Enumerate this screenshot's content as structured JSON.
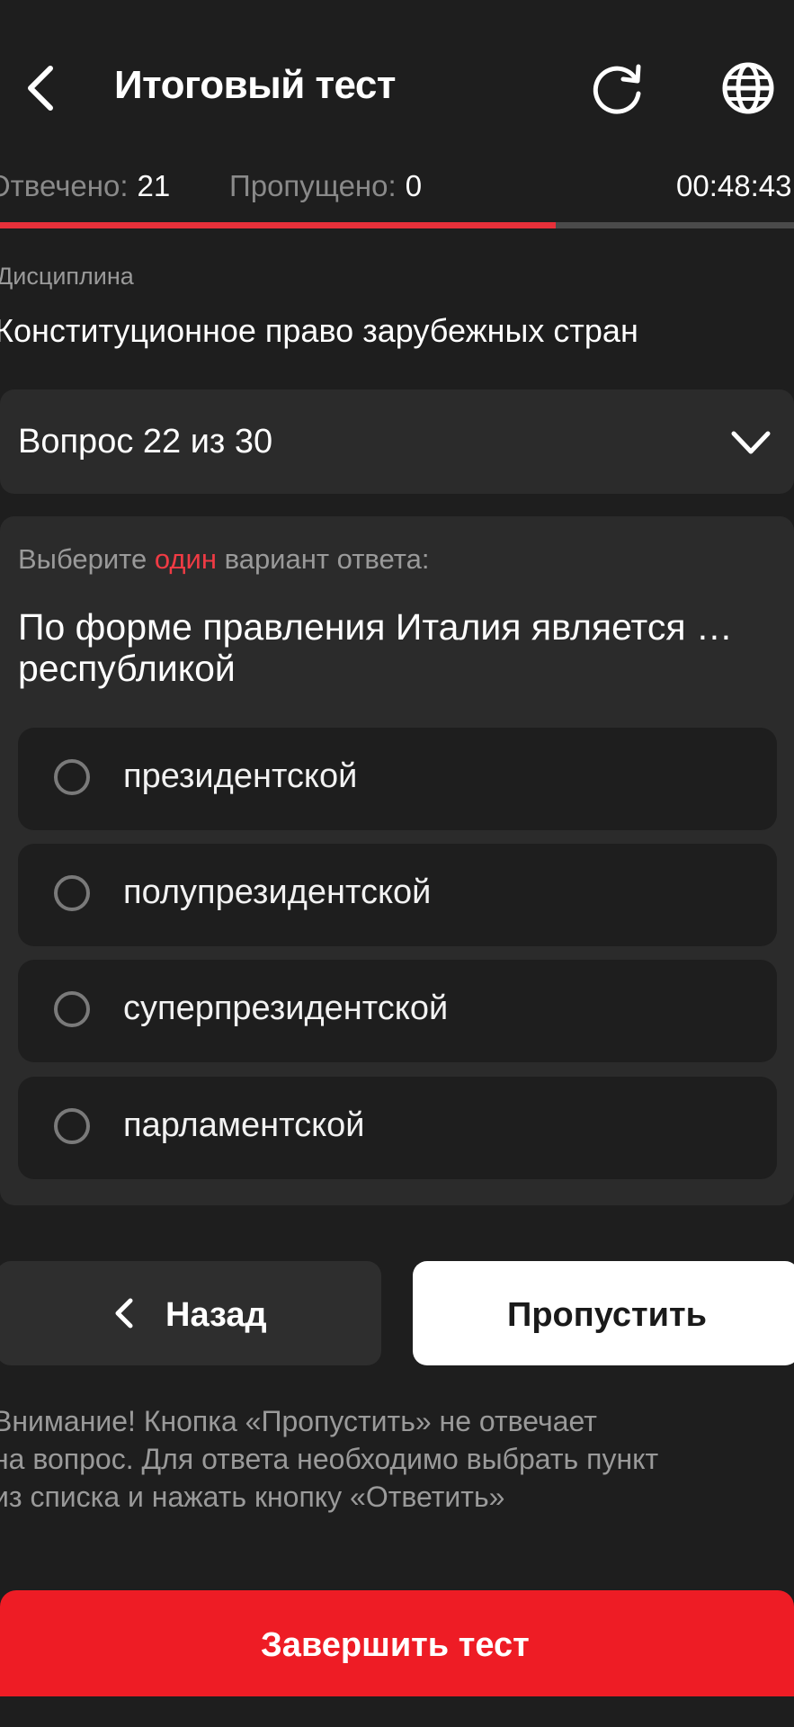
{
  "header": {
    "title": "Итоговый тест",
    "back_icon": "chevron-left-icon",
    "refresh_icon": "refresh-icon",
    "language_icon": "globe-icon"
  },
  "stats": {
    "answered_label": "Отвечено:",
    "answered_value": "21",
    "skipped_label": "Пропущено:",
    "skipped_value": "0",
    "timer": "00:48:43"
  },
  "progress": {
    "fraction": 0.7,
    "color": "#e8303a"
  },
  "discipline": {
    "label": "Дисциплина",
    "value": "Конституционное право зарубежных стран"
  },
  "question_selector": {
    "label": "Вопрос 22 из 30",
    "icon": "chevron-down-icon"
  },
  "question": {
    "instruction_before": "Выберите ",
    "instruction_accent": "один",
    "instruction_after": " вариант ответа:",
    "text": "По форме правления Италия является … республикой",
    "options": [
      {
        "label": "президентской"
      },
      {
        "label": "полупрезидентской"
      },
      {
        "label": "суперпрезидентской"
      },
      {
        "label": "парламентской"
      }
    ]
  },
  "buttons": {
    "back_label": "Назад",
    "skip_label": "Пропустить",
    "finish_label": "Завершить тест"
  },
  "note": {
    "lines": [
      "Внимание! Кнопка «Пропустить» не отвечает",
      "на вопрос. Для ответа необходимо выбрать пункт",
      "из списка и нажать кнопку «Ответить»"
    ]
  },
  "colors": {
    "accent_red": "#ee1c25",
    "background": "#1e1e1e",
    "card": "#2b2b2b"
  }
}
